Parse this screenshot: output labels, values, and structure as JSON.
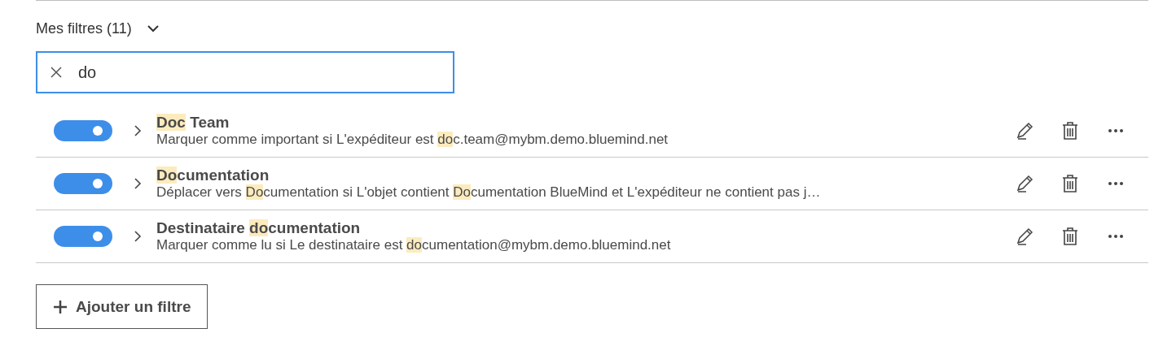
{
  "section": {
    "title": "Mes filtres (11)",
    "expanded": true
  },
  "search": {
    "value": "do"
  },
  "filters": [
    {
      "enabled": true,
      "expanded": false,
      "name": [
        {
          "text": "Doc",
          "match": true
        },
        {
          "text": " Team",
          "match": false
        }
      ],
      "description": [
        {
          "text": "Marquer comme important si L'expéditeur est ",
          "match": false
        },
        {
          "text": "do",
          "match": true
        },
        {
          "text": "c.team@mybm.demo.bluemind.net",
          "match": false
        }
      ]
    },
    {
      "enabled": true,
      "expanded": false,
      "name": [
        {
          "text": "Do",
          "match": true
        },
        {
          "text": "cumentation",
          "match": false
        }
      ],
      "description": [
        {
          "text": "Déplacer vers ",
          "match": false
        },
        {
          "text": "Do",
          "match": true
        },
        {
          "text": "cumentation si L'objet contient ",
          "match": false
        },
        {
          "text": "Do",
          "match": true
        },
        {
          "text": "cumentation BlueMind et L'expéditeur ne contient pas j…",
          "match": false
        }
      ]
    },
    {
      "enabled": true,
      "expanded": false,
      "name": [
        {
          "text": "Destinataire ",
          "match": false
        },
        {
          "text": "do",
          "match": true
        },
        {
          "text": "cumentation",
          "match": false
        }
      ],
      "description": [
        {
          "text": "Marquer comme lu si Le destinataire est ",
          "match": false
        },
        {
          "text": "do",
          "match": true
        },
        {
          "text": "cumentation@mybm.demo.bluemind.net",
          "match": false
        }
      ]
    }
  ],
  "add_button": {
    "label": "Ajouter un filtre"
  }
}
